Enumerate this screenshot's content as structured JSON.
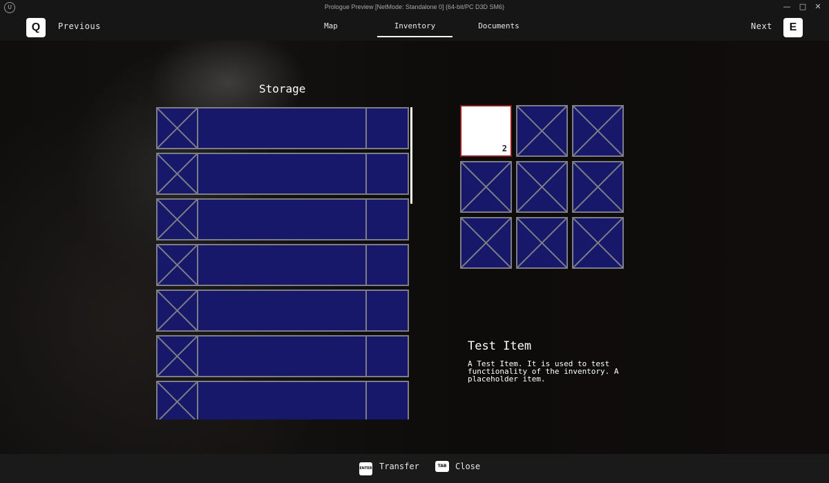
{
  "window": {
    "title": "Prologue Preview [NetMode: Standalone 0]  (64-bit/PC D3D SM6)",
    "logo_text": "U",
    "controls": {
      "minimize": "—",
      "maximize": "□",
      "close": "✕"
    }
  },
  "nav": {
    "prev_key": "Q",
    "prev_label": "Previous",
    "next_key": "E",
    "next_label": "Next",
    "tabs": [
      {
        "label": "Map",
        "active": false
      },
      {
        "label": "Inventory",
        "active": true
      },
      {
        "label": "Documents",
        "active": false
      }
    ]
  },
  "storage": {
    "title": "Storage",
    "rows": [
      "",
      "",
      "",
      "",
      "",
      "",
      ""
    ]
  },
  "inventory": {
    "slots": [
      {
        "selected": true,
        "count": "2"
      },
      {
        "selected": false,
        "count": ""
      },
      {
        "selected": false,
        "count": ""
      },
      {
        "selected": false,
        "count": ""
      },
      {
        "selected": false,
        "count": ""
      },
      {
        "selected": false,
        "count": ""
      },
      {
        "selected": false,
        "count": ""
      },
      {
        "selected": false,
        "count": ""
      },
      {
        "selected": false,
        "count": ""
      }
    ]
  },
  "item": {
    "name": "Test Item",
    "description": "A Test Item. It is used to test functionality of the inventory. A placeholder item."
  },
  "actions": {
    "transfer_key": "ENTER",
    "transfer_label": "Transfer",
    "close_key": "TAB",
    "close_label": "Close"
  },
  "colors": {
    "slot_fill": "#17186a",
    "slot_border": "#7e7e88",
    "selected_border": "#8c1a1a"
  }
}
